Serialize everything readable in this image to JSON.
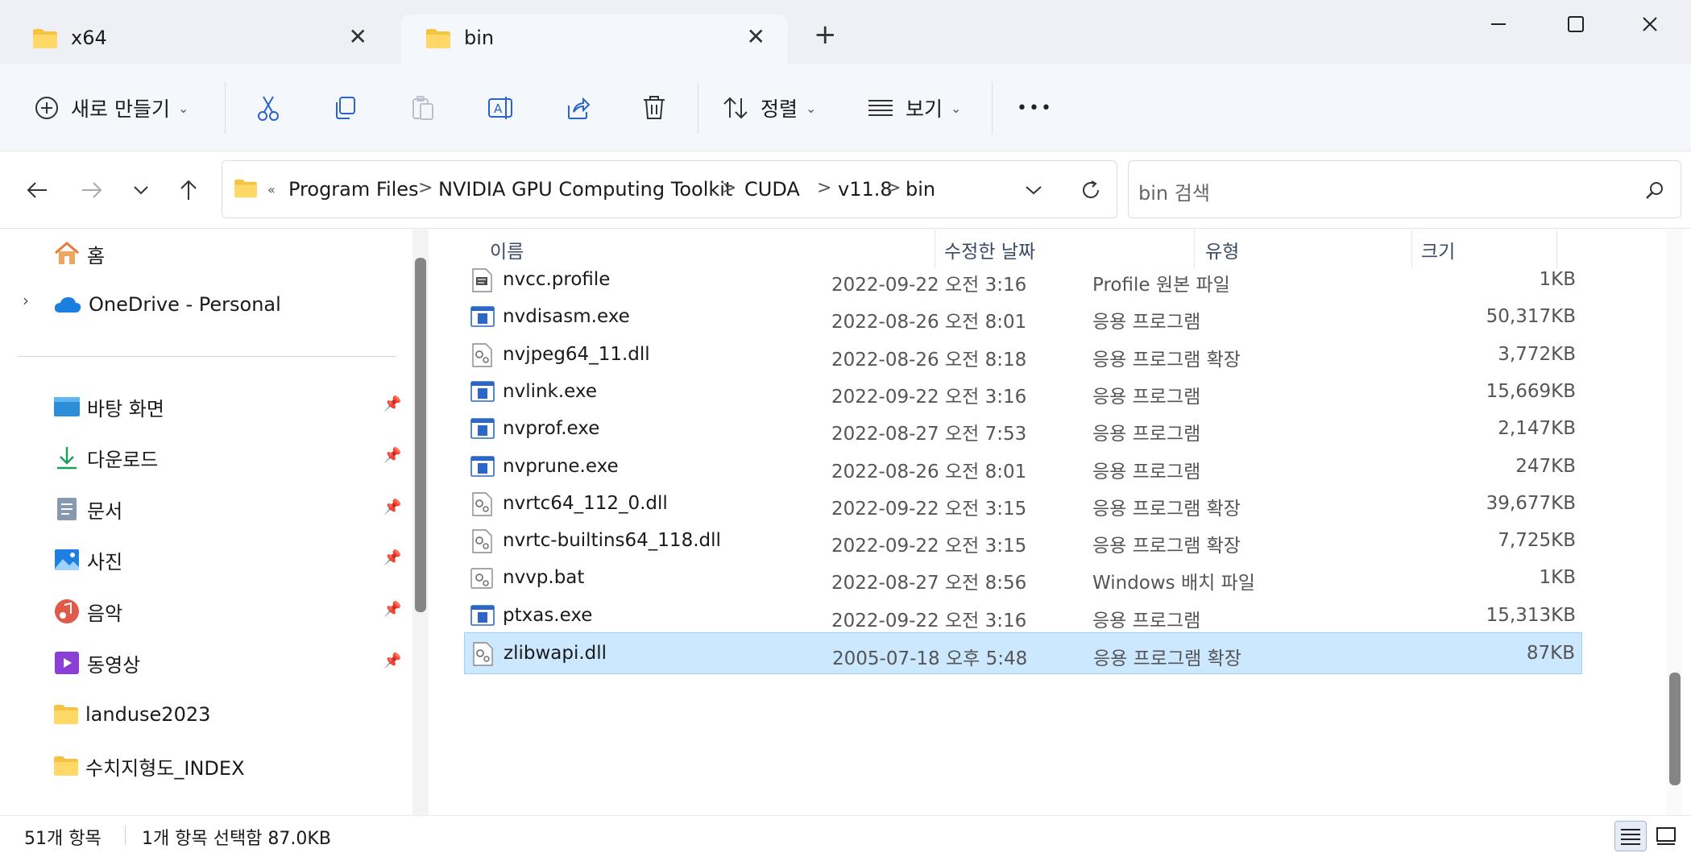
{
  "window": {
    "tabs": [
      {
        "label": "x64",
        "active": false
      },
      {
        "label": "bin",
        "active": true
      }
    ],
    "new_tab_label": "+",
    "close_tab_glyph": "✕",
    "controls": {
      "minimize": "─",
      "maximize": "☐",
      "close": "✕"
    }
  },
  "toolbar": {
    "new_label": "새로 만들기",
    "sort_label": "정렬",
    "view_label": "보기",
    "more_label": "•••",
    "icons": [
      "plus-circle-icon",
      "cut-icon",
      "copy-icon",
      "paste-icon",
      "rename-icon",
      "share-icon",
      "delete-icon",
      "sort-icon",
      "view-icon",
      "more-icon"
    ]
  },
  "address": {
    "crumbs": [
      "Program Files",
      "NVIDIA GPU Computing Toolkit",
      "CUDA",
      "v11.8",
      "bin"
    ],
    "overflow": "«",
    "separator": ">"
  },
  "search": {
    "placeholder": "bin 검색"
  },
  "sidebar": {
    "home": "홈",
    "onedrive": "OneDrive - Personal",
    "items": [
      {
        "label": "바탕 화면",
        "icon": "desktop-icon",
        "pinned": true
      },
      {
        "label": "다운로드",
        "icon": "download-icon",
        "pinned": true
      },
      {
        "label": "문서",
        "icon": "document-icon",
        "pinned": true
      },
      {
        "label": "사진",
        "icon": "pictures-icon",
        "pinned": true
      },
      {
        "label": "음악",
        "icon": "music-icon",
        "pinned": true
      },
      {
        "label": "동영상",
        "icon": "video-icon",
        "pinned": true
      },
      {
        "label": "landuse2023",
        "icon": "folder-icon",
        "pinned": false
      },
      {
        "label": "수치지형도_INDEX",
        "icon": "folder-icon",
        "pinned": false
      }
    ]
  },
  "columns": {
    "name": "이름",
    "date": "수정한 날짜",
    "type": "유형",
    "size": "크기"
  },
  "files": [
    {
      "name": "nvcc.profile",
      "date": "2022-09-22 오전 3:16",
      "type": "Profile 원본 파일",
      "size": "1KB",
      "kind": "text"
    },
    {
      "name": "nvdisasm.exe",
      "date": "2022-08-26 오전 8:01",
      "type": "응용 프로그램",
      "size": "50,317KB",
      "kind": "exe"
    },
    {
      "name": "nvjpeg64_11.dll",
      "date": "2022-08-26 오전 8:18",
      "type": "응용 프로그램 확장",
      "size": "3,772KB",
      "kind": "dll"
    },
    {
      "name": "nvlink.exe",
      "date": "2022-09-22 오전 3:16",
      "type": "응용 프로그램",
      "size": "15,669KB",
      "kind": "exe"
    },
    {
      "name": "nvprof.exe",
      "date": "2022-08-27 오전 7:53",
      "type": "응용 프로그램",
      "size": "2,147KB",
      "kind": "exe"
    },
    {
      "name": "nvprune.exe",
      "date": "2022-08-26 오전 8:01",
      "type": "응용 프로그램",
      "size": "247KB",
      "kind": "exe"
    },
    {
      "name": "nvrtc64_112_0.dll",
      "date": "2022-09-22 오전 3:15",
      "type": "응용 프로그램 확장",
      "size": "39,677KB",
      "kind": "dll"
    },
    {
      "name": "nvrtc-builtins64_118.dll",
      "date": "2022-09-22 오전 3:15",
      "type": "응용 프로그램 확장",
      "size": "7,725KB",
      "kind": "dll"
    },
    {
      "name": "nvvp.bat",
      "date": "2022-08-27 오전 8:56",
      "type": "Windows 배치 파일",
      "size": "1KB",
      "kind": "bat"
    },
    {
      "name": "ptxas.exe",
      "date": "2022-09-22 오전 3:16",
      "type": "응용 프로그램",
      "size": "15,313KB",
      "kind": "exe"
    },
    {
      "name": "zlibwapi.dll",
      "date": "2005-07-18 오후 5:48",
      "type": "응용 프로그램 확장",
      "size": "87KB",
      "kind": "dll",
      "selected": true
    }
  ],
  "status": {
    "count": "51개 항목",
    "selection": "1개 항목 선택함 87.0KB"
  },
  "colors": {
    "accent": "#0067c0",
    "selection": "#cce8ff",
    "folder": "#f5c342"
  }
}
